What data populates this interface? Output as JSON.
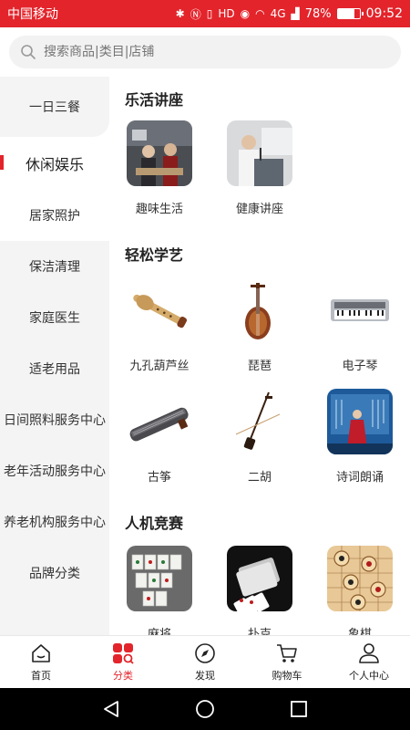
{
  "status": {
    "carrier": "中国移动",
    "network": "4G",
    "battery": "78%",
    "time": "09:52",
    "battery_level": 0.78
  },
  "search": {
    "placeholder": "搜索商品|类目|店铺"
  },
  "sidebar": {
    "items": [
      {
        "label": "一日三餐"
      },
      {
        "label": "休闲娱乐"
      },
      {
        "label": "居家照护"
      },
      {
        "label": "保洁清理"
      },
      {
        "label": "家庭医生"
      },
      {
        "label": "适老用品"
      },
      {
        "label": "日间照料服务中心"
      },
      {
        "label": "老年活动服务中心"
      },
      {
        "label": "养老机构服务中心"
      },
      {
        "label": "品牌分类"
      }
    ],
    "active": "休闲娱乐"
  },
  "sections": [
    {
      "title": "乐活讲座",
      "items": [
        {
          "label": "趣味生活"
        },
        {
          "label": "健康讲座"
        }
      ]
    },
    {
      "title": "轻松学艺",
      "items": [
        {
          "label": "九孔葫芦丝"
        },
        {
          "label": "琵琶"
        },
        {
          "label": "电子琴"
        },
        {
          "label": "古筝"
        },
        {
          "label": "二胡"
        },
        {
          "label": "诗词朗诵"
        }
      ]
    },
    {
      "title": "人机竞赛",
      "items": [
        {
          "label": "麻将"
        },
        {
          "label": "扑克"
        },
        {
          "label": "象棋"
        }
      ]
    }
  ],
  "tabbar": {
    "items": [
      {
        "label": "首页"
      },
      {
        "label": "分类"
      },
      {
        "label": "发现"
      },
      {
        "label": "购物车"
      },
      {
        "label": "个人中心"
      }
    ],
    "active": "分类"
  },
  "colors": {
    "accent": "#e3242b",
    "sidebar_bg": "#f4f4f4",
    "search_bg": "#f2f2f2"
  }
}
